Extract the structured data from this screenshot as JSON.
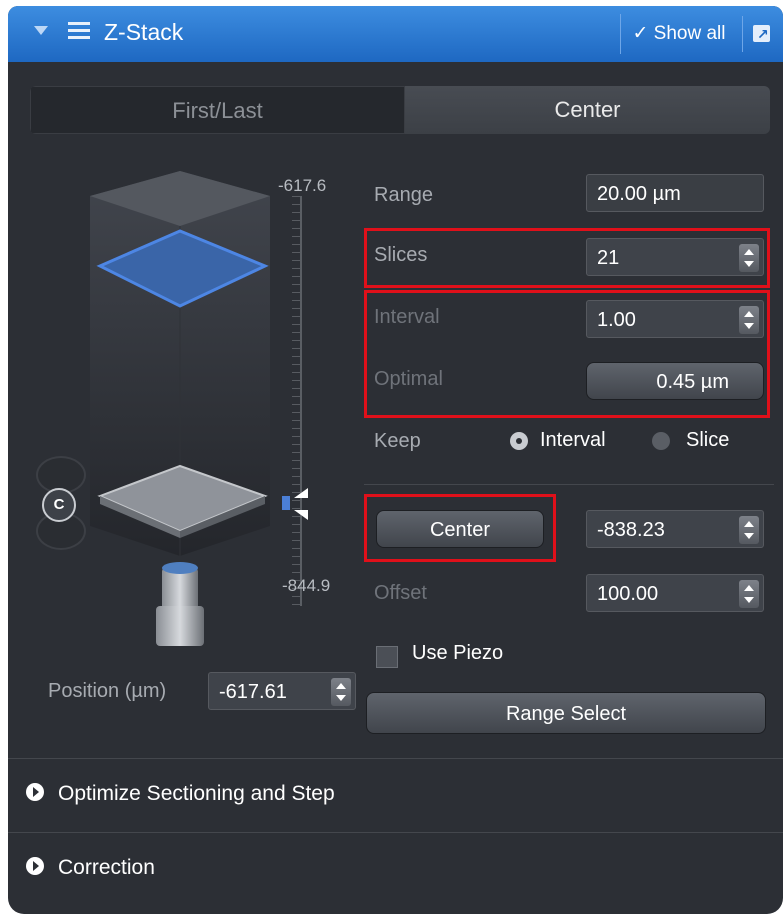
{
  "titlebar": {
    "title": "Z-Stack",
    "show_all": "✓ Show all",
    "menu_icon": "hamburger-icon",
    "external_icon": "external-link-icon"
  },
  "tabs": [
    {
      "label": "First/Last",
      "selected": false
    },
    {
      "label": "Center",
      "selected": true
    }
  ],
  "visual": {
    "top_label": "-617.6",
    "bottom_label": "-844.9",
    "knob_label": "C"
  },
  "position": {
    "label": "Position (µm)",
    "value": "-617.61"
  },
  "range": {
    "label": "Range",
    "value": "20.00 µm"
  },
  "slices": {
    "label": "Slices",
    "value": "21"
  },
  "interval": {
    "label": "Interval",
    "value": "1.00"
  },
  "optimal": {
    "label": "Optimal",
    "value": "0.45 µm"
  },
  "keep": {
    "label": "Keep",
    "options": [
      {
        "label": "Interval",
        "selected": true
      },
      {
        "label": "Slice",
        "selected": false
      }
    ]
  },
  "center": {
    "button_label": "Center",
    "value": "-838.23"
  },
  "offset": {
    "label": "Offset",
    "value": "100.00"
  },
  "use_piezo": {
    "label": "Use Piezo",
    "checked": false
  },
  "range_select": {
    "label": "Range Select"
  },
  "sections": [
    {
      "label": "Optimize Sectioning and Step"
    },
    {
      "label": "Correction"
    }
  ],
  "colors": {
    "accent": "#2a7ad8",
    "highlight": "#e0101a",
    "panel": "#2c2f35"
  }
}
